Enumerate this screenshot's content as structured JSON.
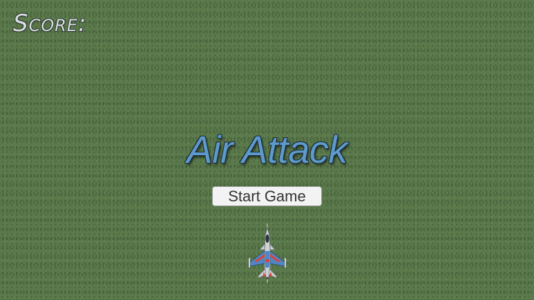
{
  "hud": {
    "score_label": "Score:"
  },
  "menu": {
    "title": "Air Attack",
    "start_button_label": "Start Game"
  },
  "player": {
    "icon": "fighter-jet-icon"
  },
  "colors": {
    "grass": "#5b7a4c",
    "title": "#5d9acb",
    "plane_body": "#4f86c6",
    "plane_accent": "#d9433b"
  }
}
